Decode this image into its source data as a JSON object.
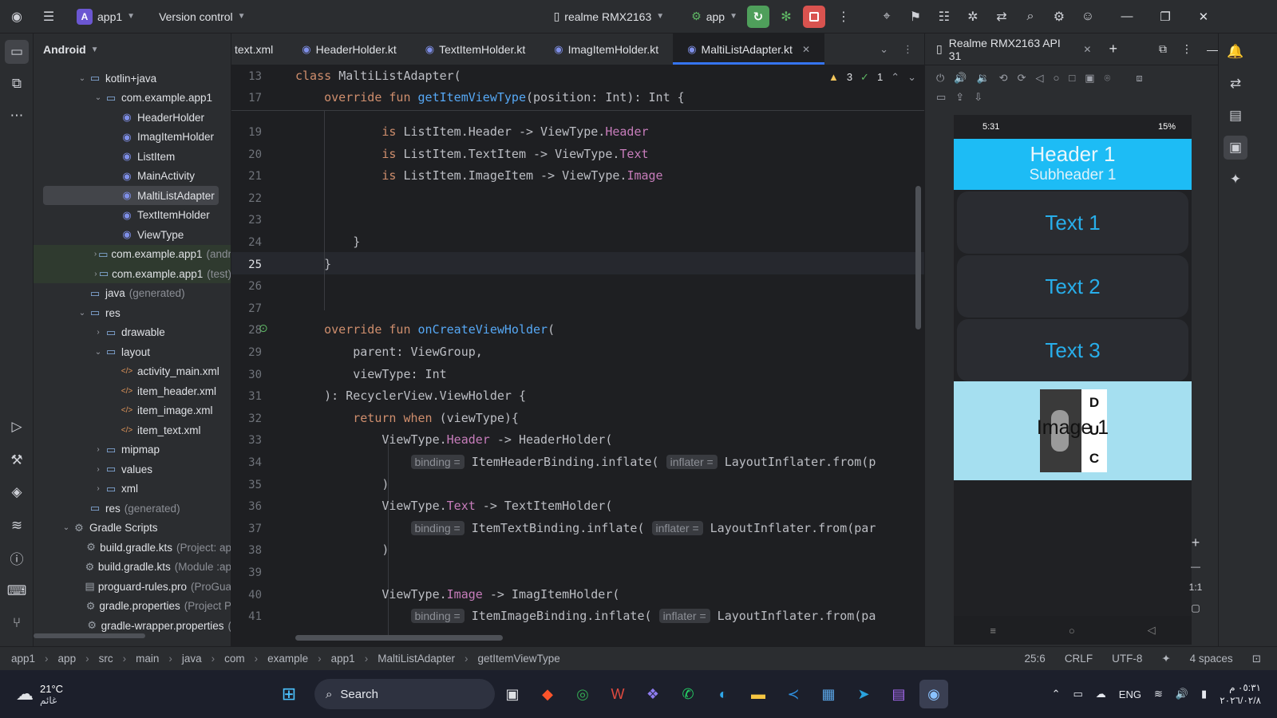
{
  "topbar": {
    "project_badge": "A",
    "project_name": "app1",
    "vcs_label": "Version control",
    "device_label": "realme RMX2163",
    "run_config": "app"
  },
  "project_panel": {
    "title": "Android",
    "tree": [
      {
        "label": "kotlin+java",
        "dim": "",
        "type": "folder",
        "depth": 2,
        "twisty": "open"
      },
      {
        "label": "com.example.app1",
        "dim": "",
        "type": "folder",
        "depth": 3,
        "twisty": "open"
      },
      {
        "label": "HeaderHolder",
        "dim": "",
        "type": "kt",
        "depth": 4,
        "twisty": ""
      },
      {
        "label": "ImagItemHolder",
        "dim": "",
        "type": "kt",
        "depth": 4,
        "twisty": ""
      },
      {
        "label": "ListItem",
        "dim": "",
        "type": "kt",
        "depth": 4,
        "twisty": ""
      },
      {
        "label": "MainActivity",
        "dim": "",
        "type": "kt",
        "depth": 4,
        "twisty": ""
      },
      {
        "label": "MaltiListAdapter",
        "dim": "",
        "type": "kt",
        "depth": 4,
        "twisty": "",
        "selected": true
      },
      {
        "label": "TextItemHolder",
        "dim": "",
        "type": "kt",
        "depth": 4,
        "twisty": ""
      },
      {
        "label": "ViewType",
        "dim": "",
        "type": "kt",
        "depth": 4,
        "twisty": ""
      },
      {
        "label": "com.example.app1",
        "dim": "(andr",
        "type": "folder",
        "depth": 3,
        "twisty": "closed",
        "highlight": true
      },
      {
        "label": "com.example.app1",
        "dim": "(test)",
        "type": "folder",
        "depth": 3,
        "twisty": "closed",
        "highlight": true
      },
      {
        "label": "java",
        "dim": "(generated)",
        "type": "folder",
        "depth": 2,
        "twisty": ""
      },
      {
        "label": "res",
        "dim": "",
        "type": "folder",
        "depth": 2,
        "twisty": "open"
      },
      {
        "label": "drawable",
        "dim": "",
        "type": "folder",
        "depth": 3,
        "twisty": "closed"
      },
      {
        "label": "layout",
        "dim": "",
        "type": "folder",
        "depth": 3,
        "twisty": "open"
      },
      {
        "label": "activity_main.xml",
        "dim": "",
        "type": "xml",
        "depth": 4,
        "twisty": ""
      },
      {
        "label": "item_header.xml",
        "dim": "",
        "type": "xml",
        "depth": 4,
        "twisty": ""
      },
      {
        "label": "item_image.xml",
        "dim": "",
        "type": "xml",
        "depth": 4,
        "twisty": ""
      },
      {
        "label": "item_text.xml",
        "dim": "",
        "type": "xml",
        "depth": 4,
        "twisty": ""
      },
      {
        "label": "mipmap",
        "dim": "",
        "type": "folder",
        "depth": 3,
        "twisty": "closed"
      },
      {
        "label": "values",
        "dim": "",
        "type": "folder",
        "depth": 3,
        "twisty": "closed"
      },
      {
        "label": "xml",
        "dim": "",
        "type": "folder",
        "depth": 3,
        "twisty": "closed"
      },
      {
        "label": "res",
        "dim": "(generated)",
        "type": "folder",
        "depth": 2,
        "twisty": ""
      },
      {
        "label": "Gradle Scripts",
        "dim": "",
        "type": "grad",
        "depth": 1,
        "twisty": "open"
      },
      {
        "label": "build.gradle.kts",
        "dim": "(Project: ap",
        "type": "grad",
        "depth": 2,
        "twisty": ""
      },
      {
        "label": "build.gradle.kts",
        "dim": "(Module :ap",
        "type": "grad",
        "depth": 2,
        "twisty": ""
      },
      {
        "label": "proguard-rules.pro",
        "dim": "(ProGua",
        "type": "file",
        "depth": 2,
        "twisty": ""
      },
      {
        "label": "gradle.properties",
        "dim": "(Project P",
        "type": "grad",
        "depth": 2,
        "twisty": ""
      },
      {
        "label": "gradle-wrapper.properties",
        "dim": "(",
        "type": "grad",
        "depth": 2,
        "twisty": ""
      }
    ]
  },
  "tabs": [
    {
      "label": "text.xml",
      "kt": false,
      "active": false
    },
    {
      "label": "HeaderHolder.kt",
      "kt": true,
      "active": false
    },
    {
      "label": "TextItemHolder.kt",
      "kt": true,
      "active": false
    },
    {
      "label": "ImagItemHolder.kt",
      "kt": true,
      "active": false
    },
    {
      "label": "MaltiListAdapter.kt",
      "kt": true,
      "active": true
    }
  ],
  "editor": {
    "warnings": "3",
    "checks": "1",
    "sticky": [
      {
        "num": "13",
        "segs": [
          {
            "t": "class ",
            "c": "kw"
          },
          {
            "t": "MaltiListAdapter(",
            "c": ""
          }
        ]
      },
      {
        "num": "17",
        "segs": [
          {
            "t": "    override fun ",
            "c": "kw"
          },
          {
            "t": "getItemViewType",
            "c": "fn"
          },
          {
            "t": "(position: Int): Int {",
            "c": ""
          }
        ]
      }
    ],
    "lines": [
      {
        "num": "19",
        "segs": [
          {
            "t": "            is ",
            "c": "kw"
          },
          {
            "t": "ListItem.Header -> ViewType.",
            "c": ""
          },
          {
            "t": "Header",
            "c": "pr"
          }
        ]
      },
      {
        "num": "20",
        "segs": [
          {
            "t": "            is ",
            "c": "kw"
          },
          {
            "t": "ListItem.TextItem -> ViewType.",
            "c": ""
          },
          {
            "t": "Text",
            "c": "pr"
          }
        ]
      },
      {
        "num": "21",
        "segs": [
          {
            "t": "            is ",
            "c": "kw"
          },
          {
            "t": "ListItem.ImageItem -> ViewType.",
            "c": ""
          },
          {
            "t": "Image",
            "c": "pr"
          }
        ]
      },
      {
        "num": "22",
        "segs": []
      },
      {
        "num": "23",
        "segs": []
      },
      {
        "num": "24",
        "segs": [
          {
            "t": "        }",
            "c": ""
          }
        ]
      },
      {
        "num": "25",
        "segs": [
          {
            "t": "    }",
            "c": ""
          }
        ],
        "current": true
      },
      {
        "num": "26",
        "segs": []
      },
      {
        "num": "27",
        "segs": []
      },
      {
        "num": "28",
        "segs": [
          {
            "t": "    override fun ",
            "c": "kw"
          },
          {
            "t": "onCreateViewHolder",
            "c": "fn"
          },
          {
            "t": "(",
            "c": ""
          }
        ]
      },
      {
        "num": "29",
        "segs": [
          {
            "t": "        parent: ViewGroup,",
            "c": ""
          }
        ]
      },
      {
        "num": "30",
        "segs": [
          {
            "t": "        viewType: Int",
            "c": ""
          }
        ]
      },
      {
        "num": "31",
        "segs": [
          {
            "t": "    ): RecyclerView.ViewHolder {",
            "c": ""
          }
        ]
      },
      {
        "num": "32",
        "segs": [
          {
            "t": "        return when ",
            "c": "kw"
          },
          {
            "t": "(viewType){",
            "c": ""
          }
        ]
      },
      {
        "num": "33",
        "segs": [
          {
            "t": "            ViewType.",
            "c": ""
          },
          {
            "t": "Header",
            "c": "pr"
          },
          {
            "t": " -> HeaderHolder(",
            "c": ""
          }
        ]
      },
      {
        "num": "34",
        "segs": [
          {
            "t": "                ",
            "c": ""
          },
          {
            "t": "binding =",
            "c": "hint"
          },
          {
            "t": " ItemHeaderBinding.inflate( ",
            "c": ""
          },
          {
            "t": "inflater =",
            "c": "hint"
          },
          {
            "t": " LayoutInflater.from(p",
            "c": ""
          }
        ]
      },
      {
        "num": "35",
        "segs": [
          {
            "t": "            )",
            "c": ""
          }
        ]
      },
      {
        "num": "36",
        "segs": [
          {
            "t": "            ViewType.",
            "c": ""
          },
          {
            "t": "Text",
            "c": "pr"
          },
          {
            "t": " -> TextItemHolder(",
            "c": ""
          }
        ]
      },
      {
        "num": "37",
        "segs": [
          {
            "t": "                ",
            "c": ""
          },
          {
            "t": "binding =",
            "c": "hint"
          },
          {
            "t": " ItemTextBinding.inflate( ",
            "c": ""
          },
          {
            "t": "inflater =",
            "c": "hint"
          },
          {
            "t": " LayoutInflater.from(par",
            "c": ""
          }
        ]
      },
      {
        "num": "38",
        "segs": [
          {
            "t": "            )",
            "c": ""
          }
        ]
      },
      {
        "num": "39",
        "segs": []
      },
      {
        "num": "40",
        "segs": [
          {
            "t": "            ViewType.",
            "c": ""
          },
          {
            "t": "Image",
            "c": "pr"
          },
          {
            "t": " -> ImagItemHolder(",
            "c": ""
          }
        ]
      },
      {
        "num": "41",
        "segs": [
          {
            "t": "                ",
            "c": ""
          },
          {
            "t": "binding =",
            "c": "hint"
          },
          {
            "t": " ItemImageBinding.inflate( ",
            "c": ""
          },
          {
            "t": "inflater =",
            "c": "hint"
          },
          {
            "t": " LayoutInflater.from(pa",
            "c": ""
          }
        ]
      }
    ]
  },
  "device_panel": {
    "title": "Realme RMX2163 API 31",
    "phone": {
      "time": "5:31",
      "battery": "15%",
      "header_title": "Header 1",
      "header_sub": "Subheader 1",
      "texts": [
        "Text 1",
        "Text 2",
        "Text 3"
      ],
      "image_label": "Image 1",
      "image_letters": [
        "D",
        "U",
        "C"
      ]
    },
    "zoom_ratio": "1:1"
  },
  "statusbar": {
    "crumbs": [
      "app1",
      "app",
      "src",
      "main",
      "java",
      "com",
      "example",
      "app1",
      "MaltiListAdapter",
      "getItemViewType"
    ],
    "position": "25:6",
    "line_sep": "CRLF",
    "encoding": "UTF-8",
    "indent": "4 spaces"
  },
  "taskbar": {
    "temperature": "21°C",
    "location": "غائم",
    "search": "Search",
    "lang": "ENG",
    "time": "٠٥:٣١ م",
    "date": "٢٠٢٦/٠٢/٨"
  }
}
